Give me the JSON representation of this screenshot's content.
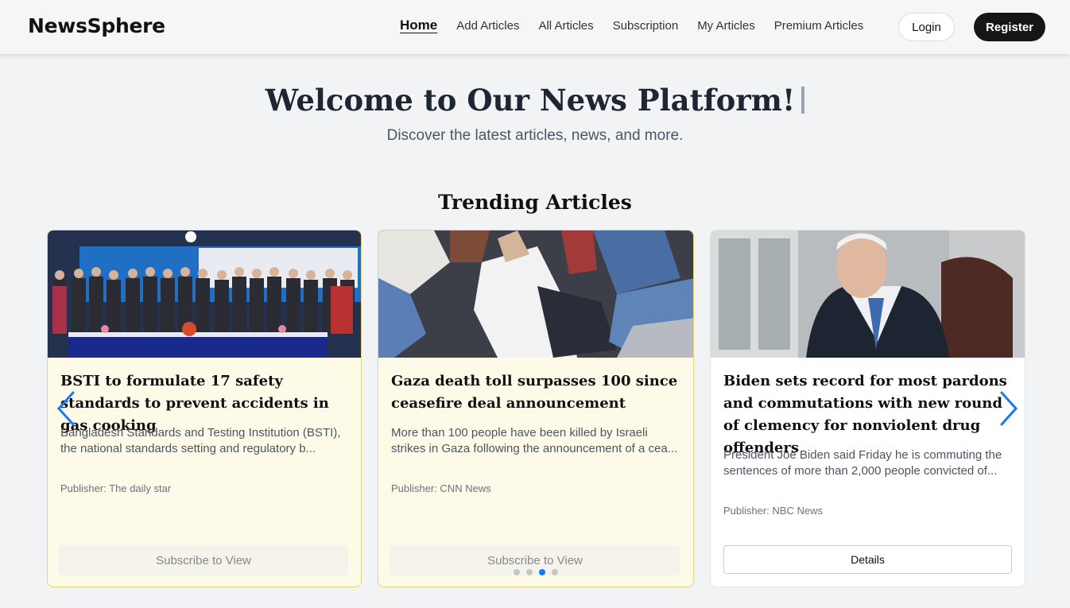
{
  "navbar": {
    "brand": "NewsSphere",
    "links": [
      {
        "label": "Home",
        "active": true
      },
      {
        "label": "Add Articles"
      },
      {
        "label": "All Articles"
      },
      {
        "label": "Subscription"
      },
      {
        "label": "My Articles"
      },
      {
        "label": "Premium Articles"
      }
    ],
    "login_label": "Login",
    "register_label": "Register"
  },
  "hero": {
    "title": "Welcome to Our News Platform!",
    "subtitle": "Discover the latest articles, news, and more."
  },
  "trending": {
    "title": "Trending Articles",
    "cards": [
      {
        "title": "BSTI to formulate 17 safety standards to prevent accidents in gas cooking",
        "description": "Bangladesh Standards and Testing Institution (BSTI), the national standards setting and regulatory b...",
        "publisher": "Publisher: The daily star",
        "button": "Subscribe to View",
        "premium": true
      },
      {
        "title": "Gaza death toll surpasses 100 since ceasefire deal announcement",
        "description": "More than 100 people have been killed by Israeli strikes in Gaza following the announcement of a cea...",
        "publisher": "Publisher: CNN News",
        "button": "Subscribe to View",
        "premium": true
      },
      {
        "title": "Biden sets record for most pardons and commutations with new round of clemency for nonviolent drug offenders",
        "description": "President Joe Biden said Friday he is commuting the sentences of more than 2,000 people convicted of...",
        "publisher": "Publisher: NBC News",
        "button": "Details",
        "premium": false
      }
    ],
    "carousel": {
      "slide_count": 4,
      "active_slide": 3
    }
  },
  "colors": {
    "accent": "#1677ff",
    "premium_bg": "#fefae8",
    "premium_border": "#ecd27a",
    "register_bg": "#161616"
  },
  "icons": {
    "prev": "chevron-left-icon",
    "next": "chevron-right-icon"
  }
}
